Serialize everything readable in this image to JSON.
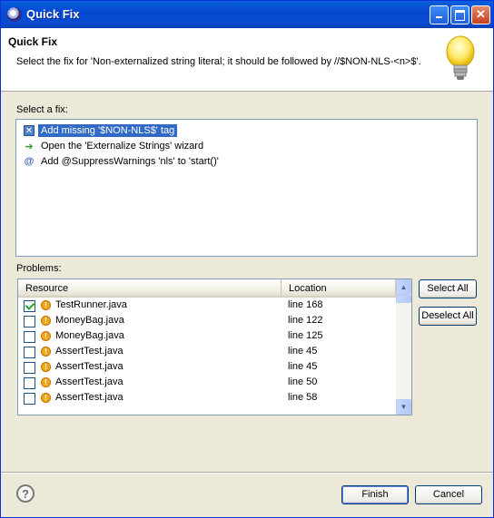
{
  "window": {
    "title": "Quick Fix"
  },
  "header": {
    "title": "Quick Fix",
    "message": "Select the fix for 'Non-externalized string literal; it should be followed by //$NON-NLS-<n>$'."
  },
  "fixes": {
    "label": "Select a fix:",
    "items": [
      {
        "label": "Add missing '$NON-NLS$' tag",
        "icon": "tag-icon",
        "selected": true
      },
      {
        "label": "Open the 'Externalize Strings' wizard",
        "icon": "wizard-arrow-icon",
        "selected": false
      },
      {
        "label": "Add @SuppressWarnings 'nls' to 'start()'",
        "icon": "annotation-icon",
        "selected": false
      }
    ]
  },
  "problems": {
    "label": "Problems:",
    "columns": {
      "resource": "Resource",
      "location": "Location"
    },
    "rows": [
      {
        "resource": "TestRunner.java",
        "location": "line 168",
        "checked": true
      },
      {
        "resource": "MoneyBag.java",
        "location": "line 122",
        "checked": false
      },
      {
        "resource": "MoneyBag.java",
        "location": "line 125",
        "checked": false
      },
      {
        "resource": "AssertTest.java",
        "location": "line 45",
        "checked": false
      },
      {
        "resource": "AssertTest.java",
        "location": "line 45",
        "checked": false
      },
      {
        "resource": "AssertTest.java",
        "location": "line 50",
        "checked": false
      },
      {
        "resource": "AssertTest.java",
        "location": "line 58",
        "checked": false
      }
    ],
    "select_all": "Select All",
    "deselect_all": "Deselect All"
  },
  "footer": {
    "help": "?",
    "finish": "Finish",
    "cancel": "Cancel"
  },
  "colors": {
    "title_bar": "#0a5fdc",
    "selection": "#316ac5",
    "dialog_bg": "#ece9d8"
  }
}
